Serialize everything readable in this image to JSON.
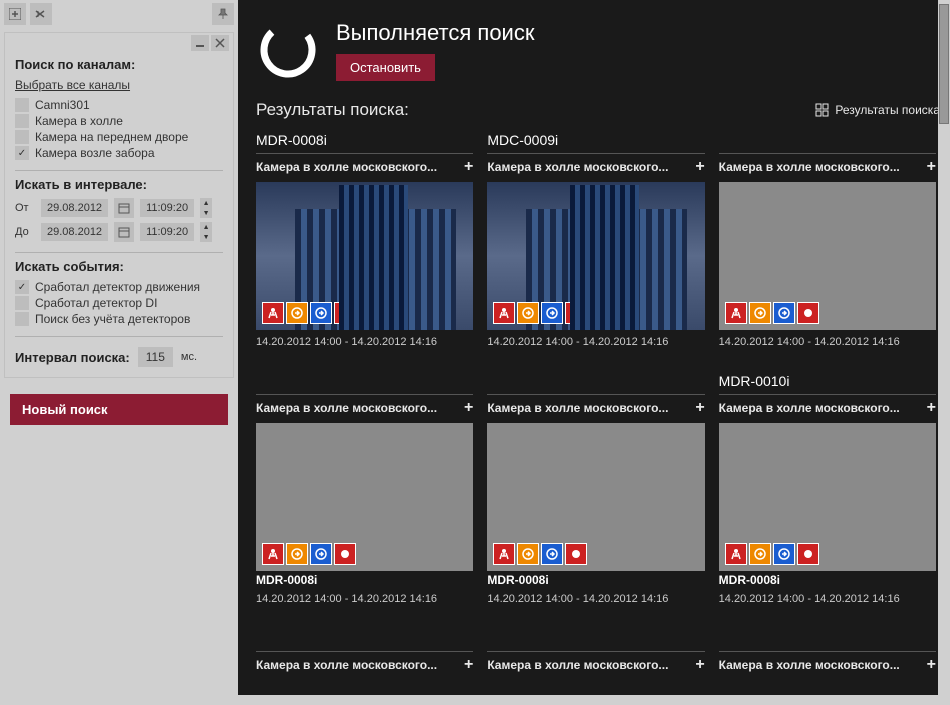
{
  "sidebar": {
    "channels_title": "Поиск по каналам:",
    "select_all": "Выбрать все каналы",
    "channels": [
      {
        "label": "Camni301",
        "checked": false
      },
      {
        "label": "Камера в холле",
        "checked": false
      },
      {
        "label": "Камера на переднем дворе",
        "checked": false
      },
      {
        "label": "Камера возле забора",
        "checked": true
      }
    ],
    "interval_title": "Искать в интервале:",
    "from_label": "От",
    "to_label": "До",
    "date_from": "29.08.2012",
    "time_from": "11:09:20",
    "date_to": "29.08.2012",
    "time_to": "11:09:20",
    "events_title": "Искать события:",
    "events": [
      {
        "label": "Сработал детектор движения",
        "checked": true
      },
      {
        "label": "Сработал детектор DI",
        "checked": false
      },
      {
        "label": "Поиск без учёта детекторов",
        "checked": false
      }
    ],
    "search_interval_label": "Интервал поиска:",
    "search_interval_value": "115",
    "search_interval_unit": "мс.",
    "new_search_btn": "Новый поиск"
  },
  "main": {
    "searching_title": "Выполняется поиск",
    "stop_btn": "Остановить",
    "results_title": "Результаты поиска:",
    "results_link": "Результаты поиска",
    "cells": [
      {
        "group": "MDR-0008i",
        "title": "Камера в холле московского...",
        "thumb": "building",
        "sub": "",
        "timestamp": "14.20.2012 14:00 - 14.20.2012 14:16"
      },
      {
        "group": "MDC-0009i",
        "title": "Камера в холле московского...",
        "thumb": "building",
        "sub": "",
        "timestamp": "14.20.2012 14:00 - 14.20.2012 14:16"
      },
      {
        "group": "",
        "title": "Камера в холле московского...",
        "thumb": "gray",
        "sub": "",
        "timestamp": "14.20.2012 14:00 - 14.20.2012 14:16"
      },
      {
        "group": "",
        "title": "Камера в холле московского...",
        "thumb": "gray",
        "sub": "MDR-0008i",
        "timestamp": "14.20.2012 14:00 - 14.20.2012 14:16"
      },
      {
        "group": "",
        "title": "Камера в холле московского...",
        "thumb": "gray",
        "sub": "MDR-0008i",
        "timestamp": "14.20.2012 14:00 - 14.20.2012 14:16"
      },
      {
        "group": "MDR-0010i",
        "title": "Камера в холле московского...",
        "thumb": "gray",
        "sub": "MDR-0008i",
        "timestamp": "14.20.2012 14:00 - 14.20.2012 14:16"
      },
      {
        "group": "",
        "title": "Камера в холле московского...",
        "thumb": "",
        "sub": "",
        "timestamp": ""
      },
      {
        "group": "",
        "title": "Камера в холле московского...",
        "thumb": "",
        "sub": "",
        "timestamp": ""
      },
      {
        "group": "",
        "title": "Камера в холле московского...",
        "thumb": "",
        "sub": "",
        "timestamp": ""
      }
    ]
  }
}
